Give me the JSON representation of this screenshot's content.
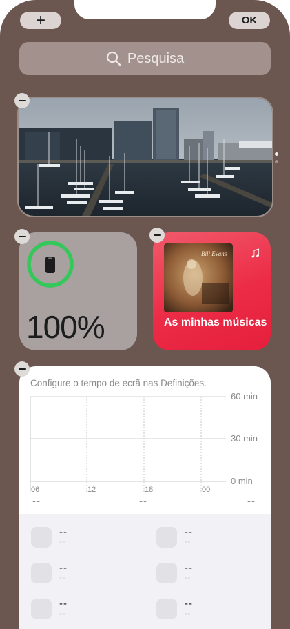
{
  "toolbar": {
    "add_label": "+",
    "done_label": "OK"
  },
  "search": {
    "label": "Pesquisa"
  },
  "photo_widget": {
    "page_indicator": {
      "count": 2,
      "active": 0
    }
  },
  "battery_widget": {
    "percent_label": "100%",
    "level": 1.0,
    "ring_color": "#34c759"
  },
  "music_widget": {
    "label": "As minhas músicas",
    "album_title": "Bill Evans",
    "accent_color": "#ec2c47"
  },
  "screen_time_widget": {
    "message": "Configure o tempo de ecrã nas Definições.",
    "y_axis": [
      "60 min",
      "30 min",
      "0 min"
    ],
    "x_axis": [
      "06",
      "12",
      "18",
      "00"
    ],
    "totals": [
      "--",
      "--",
      "--"
    ],
    "apps": [
      {
        "name": "--",
        "time": "--"
      },
      {
        "name": "--",
        "time": "--"
      },
      {
        "name": "--",
        "time": "--"
      },
      {
        "name": "--",
        "time": "--"
      },
      {
        "name": "--",
        "time": "--"
      },
      {
        "name": "--",
        "time": "--"
      }
    ]
  }
}
